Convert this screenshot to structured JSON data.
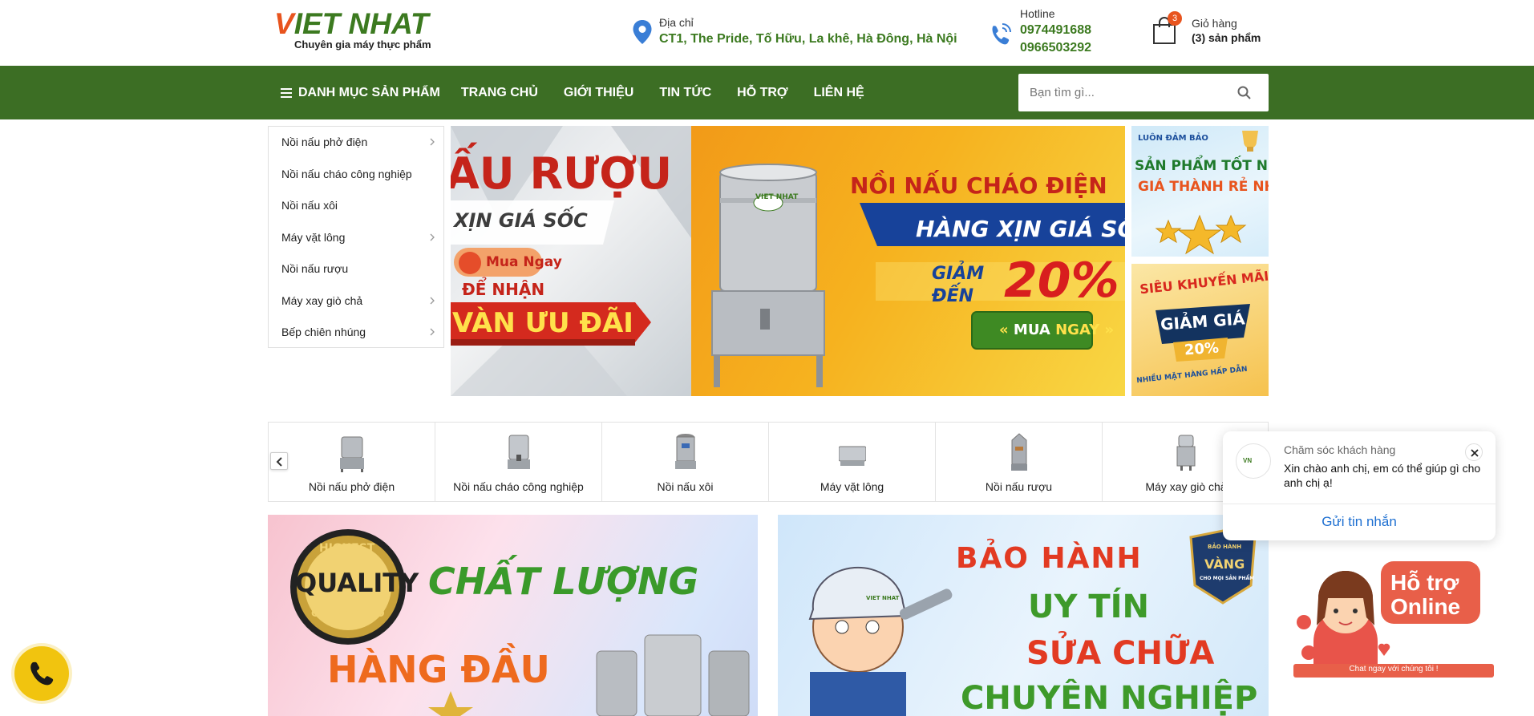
{
  "brand": {
    "logo_main": "IET NHAT",
    "logo_v": "V",
    "tagline": "Chuyên gia máy thực phẩm"
  },
  "address": {
    "label": "Địa chỉ",
    "value": "CT1, The Pride, Tố Hữu, La khê, Hà Đông, Hà Nội"
  },
  "hotline": {
    "label": "Hotline",
    "numbers": [
      "0974491688",
      "0966503292"
    ]
  },
  "cart": {
    "label": "Giỏ hàng",
    "count_text": "(3) sản phẩm",
    "badge": "3"
  },
  "nav": {
    "menu_label": "DANH MỤC SẢN PHẨM",
    "links": [
      "TRANG CHỦ",
      "GIỚI THIỆU",
      "TIN TỨC",
      "HỖ TRỢ",
      "LIÊN HỆ"
    ]
  },
  "search": {
    "placeholder": "Bạn tìm gì..."
  },
  "categories": [
    {
      "label": "Nồi nấu phở điện",
      "has_sub": true
    },
    {
      "label": "Nồi nấu cháo công nghiệp",
      "has_sub": false
    },
    {
      "label": "Nồi nấu xôi",
      "has_sub": false
    },
    {
      "label": "Máy vặt lông",
      "has_sub": true
    },
    {
      "label": "Nồi nấu rượu",
      "has_sub": false
    },
    {
      "label": "Máy xay giò chả",
      "has_sub": true
    },
    {
      "label": "Bếp chiên nhúng",
      "has_sub": true
    }
  ],
  "slider": {
    "left_slide": {
      "headline": "ẤU RƯỢU",
      "ribbon": "XỊN GIÁ SỐC",
      "buy_now": "Mua Ngay",
      "receive": "ĐỂ NHẬN",
      "offer": "VÀN ƯU ĐÃI"
    },
    "main_slide": {
      "headline": "NỒI NẤU CHÁO ĐIỆN",
      "ribbon": "HÀNG XỊN GIÁ SỐ",
      "discount_prefix_1": "GIẢM",
      "discount_prefix_2": "ĐẾN",
      "discount": "20%",
      "cta_mua": "MUA",
      "cta_ngay": "NGAY",
      "product_label": "VIET NHAT"
    }
  },
  "side_promos": [
    {
      "line1": "LUÔN ĐẢM BẢO",
      "line2": "SẢN PHẨM TỐT NHẤT",
      "line3": "GIÁ THÀNH RẺ NHẤT"
    },
    {
      "line1": "SIÊU KHUYẾN MÃI",
      "line2": "GIẢM GIÁ",
      "line3": "20%",
      "line4": "NHIỀU MẶT HÀNG HẤP DẪN"
    }
  ],
  "strip": {
    "items": [
      "Nồi nấu phở điện",
      "Nồi nấu cháo công nghiệp",
      "Nồi nấu xôi",
      "Máy vặt lông",
      "Nồi nấu rượu",
      "Máy xay giò chả"
    ]
  },
  "bottom_banners": {
    "left": {
      "seal_top": "HIGHEST",
      "seal_main": "QUALITY",
      "seal_bottom": "GUARANTEED",
      "line1": "CHẤT LƯỢNG",
      "line2": "HÀNG ĐẦU"
    },
    "right": {
      "line1": "BẢO HÀNH",
      "line2": "UY TÍN",
      "line3": "SỬA CHỮA",
      "line4": "CHUYÊN NGHIỆP",
      "badge_top": "BẢO HÀNH",
      "badge_main": "VÀNG",
      "badge_bottom": "CHO MỌI SẢN PHẨM",
      "cap_text": "VIET NHAT"
    }
  },
  "chat": {
    "title": "Chăm sóc khách hàng",
    "message": "Xin chào anh chị, em có thể giúp gì cho anh chị ạ!",
    "send_label": "Gửi tin nhắn"
  },
  "support": {
    "line1": "Hỗ trợ",
    "line2": "Online",
    "bar": "Chat ngay với chúng tôi !"
  },
  "colors": {
    "primary_green": "#3c6e24",
    "accent_orange": "#e8541e",
    "call_yellow": "#f1c40f",
    "link_blue": "#1d6fd1"
  }
}
